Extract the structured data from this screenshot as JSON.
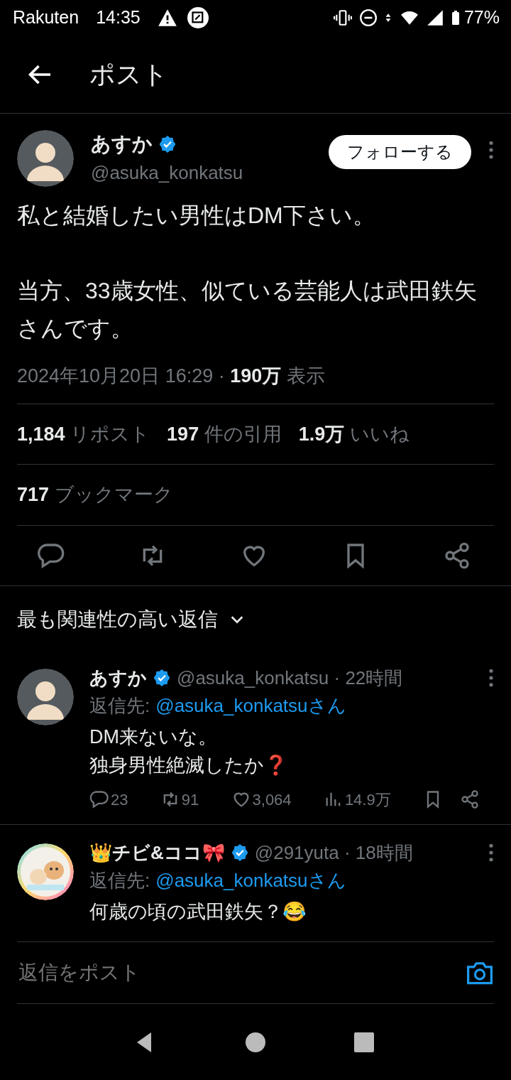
{
  "status_bar": {
    "carrier": "Rakuten",
    "time": "14:35",
    "battery": "77%"
  },
  "header": {
    "title": "ポスト"
  },
  "post": {
    "author": {
      "name": "あすか",
      "verified": true,
      "handle": "@asuka_konkatsu"
    },
    "follow_button": "フォローする",
    "paragraphs": [
      "私と結婚したい男性はDM下さい。",
      "当方、33歳女性、似ている芸能人は武田鉄矢さんです。"
    ],
    "meta": "2024年10月20日 16:29 · **190万** 表示",
    "stats": [
      "**1,184** リポスト",
      "**197** 件の引用",
      "**1.9万** いいね"
    ],
    "bookmarks": "**717** ブックマーク"
  },
  "replies_sort": "最も関連性の高い返信",
  "replies": [
    {
      "name": "あすか",
      "verified": true,
      "handle_time": "@asuka_konkatsu · 22時間",
      "reply_to_label": "返信先:",
      "reply_to": "@asuka_konkatsuさん",
      "lines": [
        "DM来ないな。",
        "独身男性絶滅したか❓"
      ],
      "counts": {
        "replies": "23",
        "reposts": "91",
        "likes": "3,064",
        "views": "14.9万"
      }
    },
    {
      "name": "👑チビ&ココ🎀",
      "verified": true,
      "handle_time": "@291yuta · 18時間",
      "avatar": {
        "kind": "picture"
      },
      "reply_to_label": "返信先:",
      "reply_to": "@asuka_konkatsuさん",
      "lines": [
        "何歳の頃の武田鉄矢？😂"
      ]
    }
  ],
  "composer": {
    "placeholder": "返信をポスト"
  }
}
